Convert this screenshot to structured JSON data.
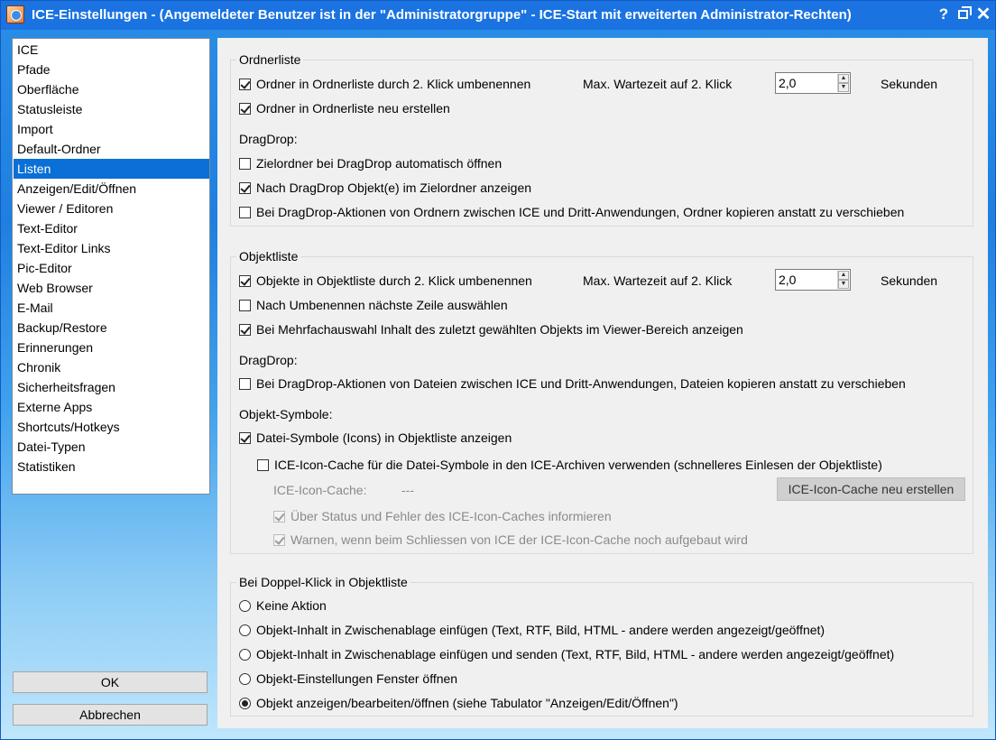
{
  "window": {
    "title": "ICE-Einstellungen - (Angemeldeter Benutzer ist in der \"Administratorgruppe\" - ICE-Start mit erweiterten Administrator-Rechten)",
    "help_glyph": "?",
    "close_glyph": "✕"
  },
  "nav": {
    "items": [
      {
        "label": "ICE"
      },
      {
        "label": "Pfade"
      },
      {
        "label": "Oberfläche"
      },
      {
        "label": "Statusleiste"
      },
      {
        "label": "Import"
      },
      {
        "label": "Default-Ordner"
      },
      {
        "label": "Listen"
      },
      {
        "label": "Anzeigen/Edit/Öffnen"
      },
      {
        "label": "Viewer / Editoren"
      },
      {
        "label": "Text-Editor"
      },
      {
        "label": "Text-Editor Links"
      },
      {
        "label": "Pic-Editor"
      },
      {
        "label": "Web Browser"
      },
      {
        "label": "E-Mail"
      },
      {
        "label": "Backup/Restore"
      },
      {
        "label": "Erinnerungen"
      },
      {
        "label": "Chronik"
      },
      {
        "label": "Sicherheitsfragen"
      },
      {
        "label": "Externe Apps"
      },
      {
        "label": "Shortcuts/Hotkeys"
      },
      {
        "label": "Datei-Typen"
      },
      {
        "label": "Statistiken"
      }
    ],
    "selected": "Listen"
  },
  "buttons": {
    "ok": "OK",
    "cancel": "Abbrechen"
  },
  "ordnerliste": {
    "legend": "Ordnerliste",
    "rename_label": "Ordner in Ordnerliste durch 2. Klick umbenennen",
    "rename_checked": true,
    "wait_label": "Max. Wartezeit auf 2. Klick",
    "wait_value": "2,0",
    "seconds_label": "Sekunden",
    "create_label": "Ordner in Ordnerliste neu erstellen",
    "create_checked": true,
    "dragdrop_heading": "DragDrop:",
    "dd_open_label": "Zielordner bei DragDrop automatisch öffnen",
    "dd_open_checked": false,
    "dd_show_label": "Nach DragDrop Objekt(e) im Zielordner anzeigen",
    "dd_show_checked": true,
    "dd_copy_label": "Bei DragDrop-Aktionen von Ordnern zwischen ICE und Dritt-Anwendungen, Ordner kopieren anstatt zu verschieben",
    "dd_copy_checked": false
  },
  "objektliste": {
    "legend": "Objektliste",
    "rename_label": "Objekte in Objektliste durch 2. Klick umbenennen",
    "rename_checked": true,
    "wait_label": "Max. Wartezeit auf 2. Klick",
    "wait_value": "2,0",
    "seconds_label": "Sekunden",
    "next_row_label": "Nach Umbenennen nächste Zeile auswählen",
    "next_row_checked": false,
    "multi_label": "Bei Mehrfachauswahl Inhalt des zuletzt gewählten Objekts im Viewer-Bereich anzeigen",
    "multi_checked": true,
    "dragdrop_heading": "DragDrop:",
    "dd_copy_label": "Bei DragDrop-Aktionen von Dateien zwischen ICE und Dritt-Anwendungen, Dateien kopieren anstatt zu verschieben",
    "dd_copy_checked": false,
    "symbols_heading": "Objekt-Symbole:",
    "icons_label": "Datei-Symbole (Icons) in Objektliste anzeigen",
    "icons_checked": true,
    "cache_label": "ICE-Icon-Cache für die Datei-Symbole in den ICE-Archiven verwenden (schnelleres Einlesen der Objektliste)",
    "cache_checked": false,
    "cache_status_label": "ICE-Icon-Cache:",
    "cache_status_value": "---",
    "cache_rebuild_button": "ICE-Icon-Cache neu erstellen",
    "inform_label": "Über Status und Fehler des ICE-Icon-Caches informieren",
    "inform_checked": true,
    "warn_label": "Warnen, wenn beim Schliessen von ICE der ICE-Icon-Cache noch aufgebaut wird",
    "warn_checked": true
  },
  "doppelklick": {
    "legend": "Bei Doppel-Klick in Objektliste",
    "options": [
      {
        "label": "Keine Aktion",
        "checked": false
      },
      {
        "label": "Objekt-Inhalt in Zwischenablage einfügen (Text, RTF, Bild, HTML - andere werden angezeigt/geöffnet)",
        "checked": false
      },
      {
        "label": "Objekt-Inhalt in Zwischenablage einfügen und senden  (Text, RTF, Bild, HTML - andere werden angezeigt/geöffnet)",
        "checked": false
      },
      {
        "label": "Objekt-Einstellungen Fenster öffnen",
        "checked": false
      },
      {
        "label": "Objekt anzeigen/bearbeiten/öffnen (siehe Tabulator \"Anzeigen/Edit/Öffnen\")",
        "checked": true
      }
    ]
  }
}
